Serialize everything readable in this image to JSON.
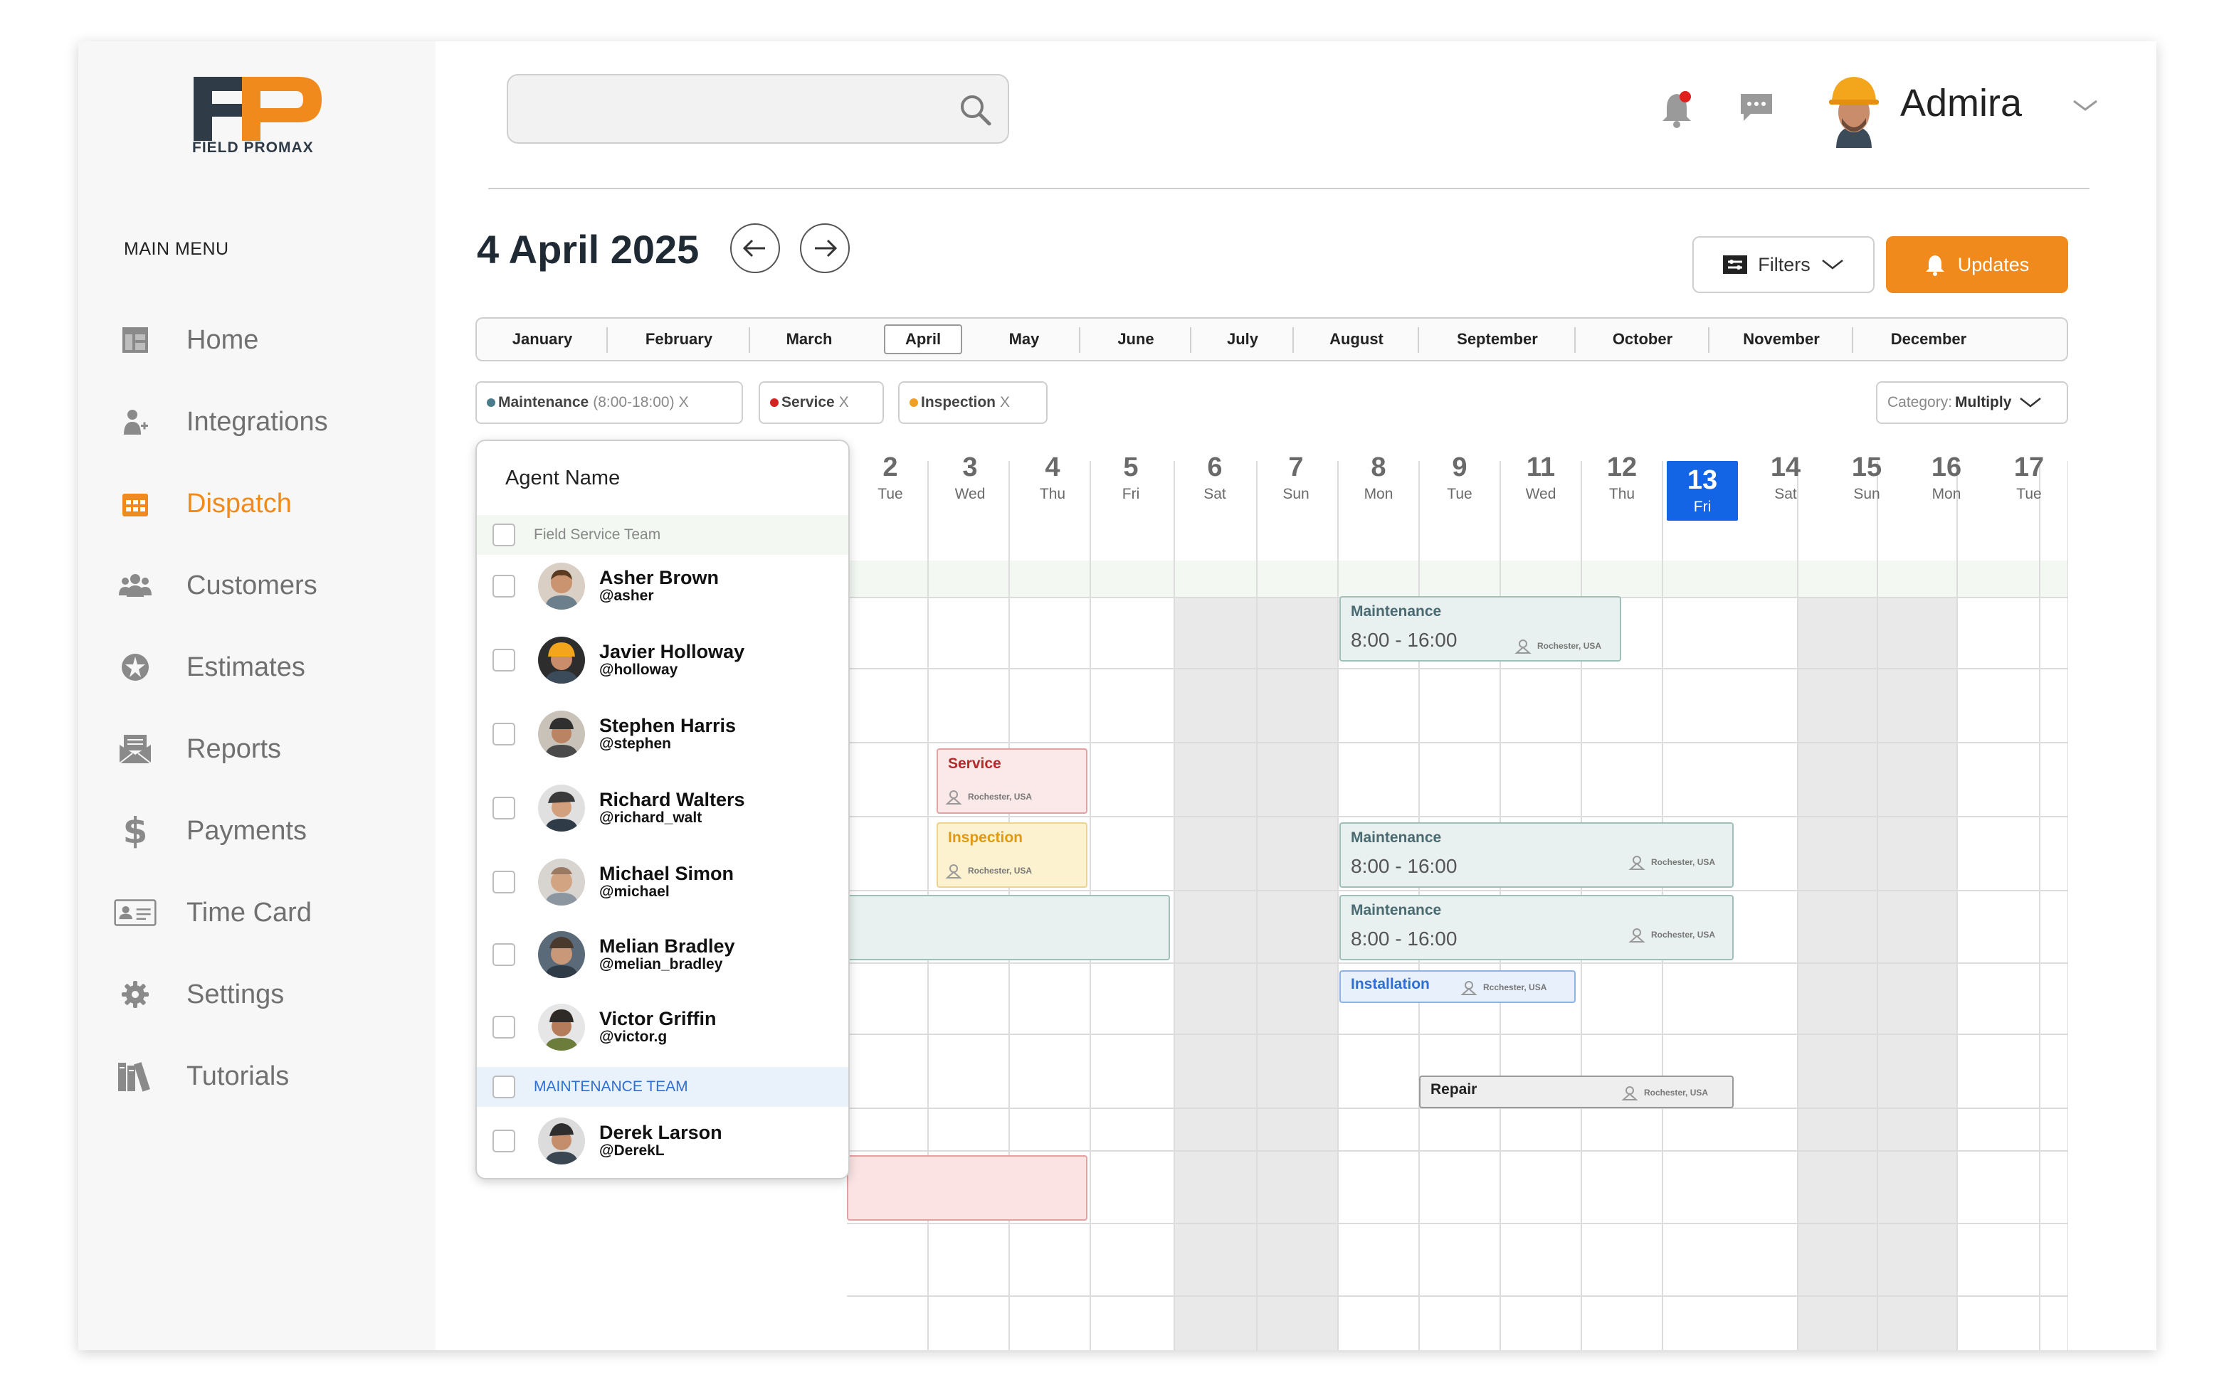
{
  "brand": {
    "name": "FIELD PROMAX",
    "accent": "#f08a1c",
    "dark": "#2f3b46"
  },
  "sidebar": {
    "menu_title": "MAIN MENU",
    "items": [
      {
        "label": "Home",
        "icon": "home-icon",
        "active": false
      },
      {
        "label": "Integrations",
        "icon": "user-plus-icon",
        "active": false
      },
      {
        "label": "Dispatch",
        "icon": "calendar-grid-icon",
        "active": true
      },
      {
        "label": "Customers",
        "icon": "people-icon",
        "active": false
      },
      {
        "label": "Estimates",
        "icon": "estimate-icon",
        "active": false
      },
      {
        "label": "Reports",
        "icon": "envelope-icon",
        "active": false
      },
      {
        "label": "Payments",
        "icon": "dollar-icon",
        "active": false
      },
      {
        "label": "Time Card",
        "icon": "id-card-icon",
        "active": false
      },
      {
        "label": "Settings",
        "icon": "gear-icon",
        "active": false
      },
      {
        "label": "Tutorials",
        "icon": "books-icon",
        "active": false
      }
    ]
  },
  "header": {
    "search": {
      "value": "",
      "placeholder": ""
    },
    "user_name": "Admira"
  },
  "toolbar": {
    "date_title": "4 April 2025",
    "filters_label": "Filters",
    "updates_label": "Updates",
    "category_label": "Category:",
    "category_value": "Multiply"
  },
  "months": [
    "January",
    "February",
    "March",
    "April",
    "May",
    "June",
    "July",
    "August",
    "September",
    "October",
    "November",
    "December"
  ],
  "active_month": "April",
  "chips": [
    {
      "label": "Maintenance",
      "detail": "(8:00-18:00)",
      "close": "X",
      "color": "#4a7c8c"
    },
    {
      "label": "Service",
      "detail": "",
      "close": "X",
      "color": "#d32020"
    },
    {
      "label": "Inspection",
      "detail": "",
      "close": "X",
      "color": "#f0a020"
    }
  ],
  "days": [
    {
      "num": "2",
      "name": "Tue"
    },
    {
      "num": "3",
      "name": "Wed"
    },
    {
      "num": "4",
      "name": "Thu"
    },
    {
      "num": "5",
      "name": "Fri"
    },
    {
      "num": "6",
      "name": "Sat"
    },
    {
      "num": "7",
      "name": "Sun"
    },
    {
      "num": "8",
      "name": "Mon"
    },
    {
      "num": "9",
      "name": "Tue"
    },
    {
      "num": "11",
      "name": "Wed"
    },
    {
      "num": "12",
      "name": "Thu"
    },
    {
      "num": "13",
      "name": "Fri"
    },
    {
      "num": "14",
      "name": "Sat"
    },
    {
      "num": "15",
      "name": "Sun"
    },
    {
      "num": "16",
      "name": "Mon"
    },
    {
      "num": "17",
      "name": "Tue"
    }
  ],
  "today": "13",
  "agent_panel": {
    "title": "Agent Name",
    "groups": [
      {
        "label": "Field Service Team",
        "color": "#888888"
      },
      {
        "label": "MAINTENANCE TEAM",
        "color": "#2f6fd0"
      }
    ],
    "agents": [
      {
        "name": "Asher Brown",
        "handle": "@asher"
      },
      {
        "name": "Javier Holloway",
        "handle": "@holloway"
      },
      {
        "name": "Stephen Harris",
        "handle": "@stephen"
      },
      {
        "name": "Richard Walters",
        "handle": "@richard_walt"
      },
      {
        "name": "Michael Simon",
        "handle": "@michael"
      },
      {
        "name": "Melian Bradley",
        "handle": "@melian_bradley"
      },
      {
        "name": "Victor Griffin",
        "handle": "@victor.g"
      },
      {
        "name": "Derek Larson",
        "handle": "@DerekL"
      }
    ]
  },
  "events": [
    {
      "title": "Maintenance",
      "time": "8:00 - 16:00",
      "location": "Rochester, USA",
      "kind": "maintenance"
    },
    {
      "title": "Service",
      "time": "",
      "location": "Rochester, USA",
      "kind": "service"
    },
    {
      "title": "Inspection",
      "time": "",
      "location": "Rochester, USA",
      "kind": "inspection"
    },
    {
      "title": "Maintenance",
      "time": "8:00 - 16:00",
      "location": "Rochester, USA",
      "kind": "maintenance"
    },
    {
      "title": "Maintenance",
      "time": "8:00 - 16:00",
      "location": "Rochester, USA",
      "kind": "maintenance"
    },
    {
      "title": "Installation",
      "time": "",
      "location": "Rcchester, USA",
      "kind": "installation"
    },
    {
      "title": "Repair",
      "time": "",
      "location": "Rochester, USA",
      "kind": "repair"
    },
    {
      "title": "",
      "time": "",
      "location": "",
      "kind": "maintenance-bar"
    },
    {
      "title": "",
      "time": "",
      "location": "",
      "kind": "service-bar"
    }
  ]
}
